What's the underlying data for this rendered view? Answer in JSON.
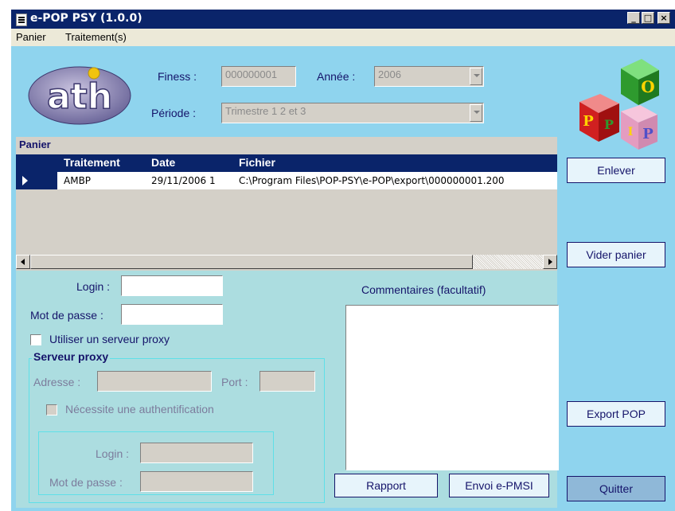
{
  "window": {
    "title": "e-POP PSY (1.0.0)"
  },
  "menu": {
    "items": [
      "Panier",
      "Traitement(s)"
    ]
  },
  "header": {
    "logo_text": "ath",
    "finess_label": "Finess :",
    "finess_value": "000000001",
    "annee_label": "Année :",
    "annee_value": "2006",
    "periode_label": "Période :",
    "periode_value": "Trimestre 1 2 et 3",
    "cube_letters": [
      "P",
      "O",
      "P",
      "P",
      "I"
    ]
  },
  "panier": {
    "title": "Panier",
    "columns": [
      "Traitement",
      "Date",
      "Fichier"
    ],
    "rows": [
      {
        "traitement": "AMBP",
        "date": "29/11/2006 1",
        "fichier": "C:\\Program Files\\POP-PSY\\e-POP\\export\\000000001.200"
      }
    ]
  },
  "side_buttons": {
    "enlever": "Enlever",
    "vider": "Vider panier",
    "export": "Export POP",
    "quitter": "Quitter"
  },
  "auth": {
    "login_label": "Login :",
    "login_value": "",
    "password_label": "Mot de passe :",
    "password_value": "",
    "proxy_checkbox": "Utiliser un serveur proxy"
  },
  "proxy": {
    "legend": "Serveur proxy",
    "adresse_label": "Adresse :",
    "port_label": "Port :",
    "auth_checkbox": "Nécessite une authentification",
    "login_label": "Login :",
    "password_label": "Mot de passe :"
  },
  "comments": {
    "label": "Commentaires (facultatif)",
    "value": ""
  },
  "bottom_buttons": {
    "rapport": "Rapport",
    "envoi": "Envoi e-PMSI"
  },
  "colors": {
    "titlebar": "#0a246a",
    "window_bg": "#8fd4ee",
    "panel_bg": "#acdde0",
    "accent_text": "#15146a"
  }
}
